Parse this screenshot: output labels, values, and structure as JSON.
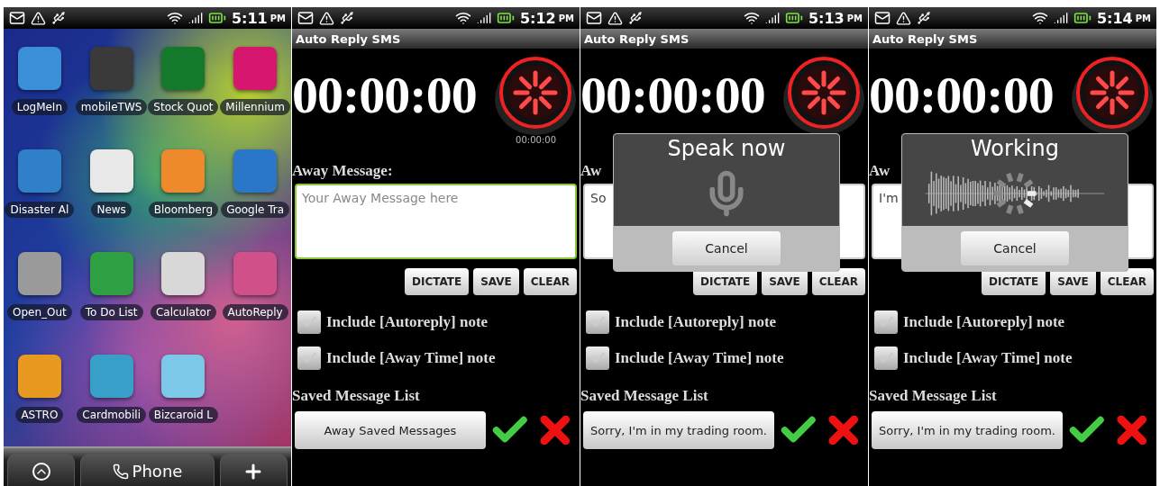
{
  "screens": [
    {
      "kind": "home",
      "status": {
        "time": "5:11",
        "meridiem": "PM"
      },
      "apps": [
        {
          "label": "LogMeIn",
          "color": "#3a8fd8"
        },
        {
          "label": "mobileTWS",
          "color": "#3a3a3a"
        },
        {
          "label": "Stock Quot",
          "color": "#137a2c"
        },
        {
          "label": "Millennium",
          "color": "#d6166f"
        },
        {
          "label": "Disaster Al",
          "color": "#2f7fc9"
        },
        {
          "label": "News",
          "color": "#e8e8e8"
        },
        {
          "label": "Bloomberg",
          "color": "#ee8a2c"
        },
        {
          "label": "Google Tra",
          "color": "#2a76c8"
        },
        {
          "label": "Open_Out",
          "color": "#9a9a9a"
        },
        {
          "label": "To Do List",
          "color": "#2ea043"
        },
        {
          "label": "Calculator",
          "color": "#d8d8d8"
        },
        {
          "label": "AutoReply",
          "color": "#d0508a"
        },
        {
          "label": "ASTRO",
          "color": "#e89a20"
        },
        {
          "label": "Cardmobili",
          "color": "#38a0c8"
        },
        {
          "label": "Bizcaroid L",
          "color": "#7cc8e8"
        }
      ],
      "dock": {
        "label": "Phone"
      }
    },
    {
      "kind": "app",
      "status": {
        "time": "5:12",
        "meridiem": "PM"
      },
      "title": "Auto Reply SMS",
      "timer": "00:00:00",
      "small_timer": "00:00:00",
      "away_label": "Away Message:",
      "message": {
        "placeholder": "Your Away Message here",
        "focused": true
      },
      "buttons": [
        "DICTATE",
        "SAVE",
        "CLEAR"
      ],
      "options": [
        {
          "label": "Include [Autoreply] note",
          "checked": false
        },
        {
          "label": "Include [Away Time] note",
          "checked": false
        }
      ],
      "saved_label": "Saved Message List",
      "saved_button": "Away Saved Messages"
    },
    {
      "kind": "app",
      "status": {
        "time": "5:13",
        "meridiem": "PM"
      },
      "title": "Auto Reply SMS",
      "timer": "00:00:00",
      "away_label": "Aw",
      "message": {
        "value": "So",
        "focused": false
      },
      "buttons": [
        "DICTATE",
        "SAVE",
        "CLEAR"
      ],
      "options": [
        {
          "label": "Include [Autoreply] note",
          "checked": false
        },
        {
          "label": "Include [Away Time] note",
          "checked": false
        }
      ],
      "saved_label": "Saved Message List",
      "saved_button": "Sorry, I'm in my trading room.",
      "dialog": {
        "kind": "speak",
        "title": "Speak now",
        "button": "Cancel"
      }
    },
    {
      "kind": "app",
      "status": {
        "time": "5:14",
        "meridiem": "PM"
      },
      "title": "Auto Reply SMS",
      "timer": "00:00:00",
      "away_label": "Aw",
      "message": {
        "value": "I'm",
        "focused": false
      },
      "buttons": [
        "DICTATE",
        "SAVE",
        "CLEAR"
      ],
      "options": [
        {
          "label": "Include [Autoreply] note",
          "checked": false
        },
        {
          "label": "Include [Away Time] note",
          "checked": false
        }
      ],
      "saved_label": "Saved Message List",
      "saved_button": "Sorry, I'm in my trading room.",
      "dialog": {
        "kind": "working",
        "title": "Working",
        "button": "Cancel"
      }
    }
  ]
}
